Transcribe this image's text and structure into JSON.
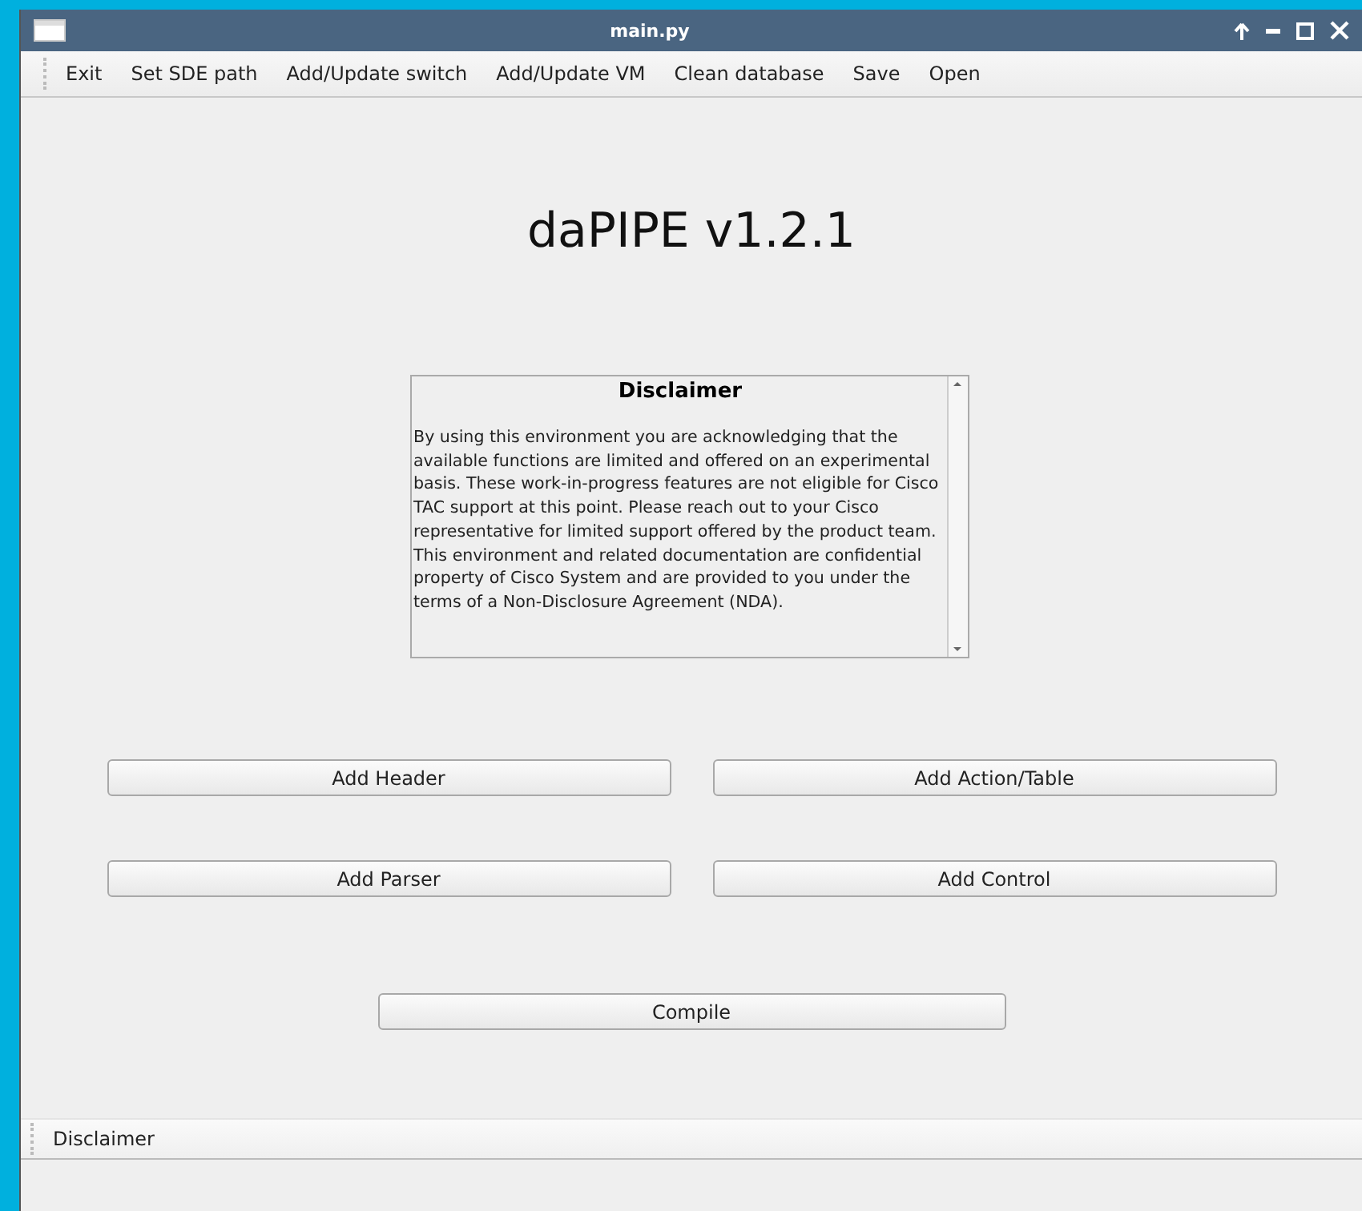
{
  "window": {
    "title": "main.py"
  },
  "menu": [
    "Exit",
    "Set SDE path",
    "Add/Update switch",
    "Add/Update VM",
    "Clean database",
    "Save",
    "Open"
  ],
  "heading": "daPIPE v1.2.1",
  "disclaimer": {
    "title": "Disclaimer",
    "text": "By using this environment you are acknowledging that the available functions are limited and offered on an experimental basis. These work-in-progress features are not eligible for Cisco TAC support at this point. Please reach out to your Cisco representative for limited support offered by the product team. This environment and related documentation are confidential property of Cisco System and are provided to you under the terms of a Non-Disclosure Agreement (NDA)."
  },
  "buttons": [
    [
      "Add Header",
      "Add Action/Table"
    ],
    [
      "Add Parser",
      "Add Control"
    ]
  ],
  "compile_button": "Compile",
  "toolbar": [
    "Disclaimer"
  ]
}
